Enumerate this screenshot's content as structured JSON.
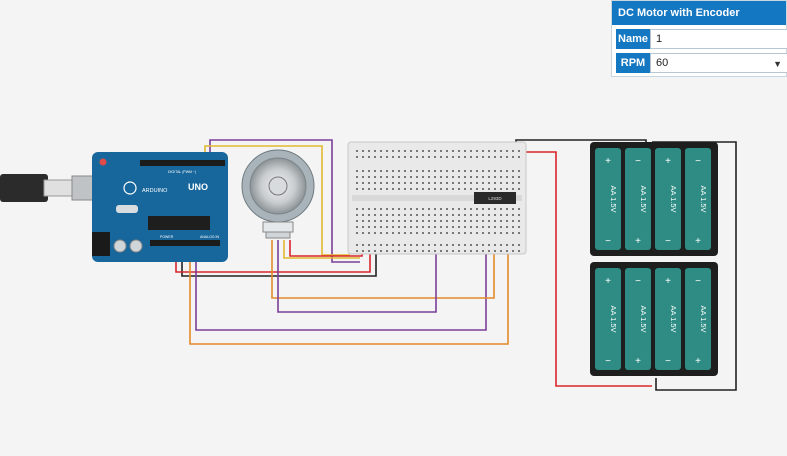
{
  "inspector": {
    "title": "DC Motor with Encoder",
    "fields": [
      {
        "label": "Name",
        "value": "1"
      },
      {
        "label": "RPM",
        "value": "60",
        "options_visible_selected": "60"
      }
    ]
  },
  "components": {
    "arduino": {
      "brand": "ARDUINO",
      "model": "UNO",
      "header_digital": "DIGITAL (PWM ~)",
      "header_power": "POWER",
      "header_analog": "ANALOG IN"
    },
    "ic": {
      "label": "L293D"
    },
    "battery": {
      "cell_label": "AA 1.5V",
      "plus": "+",
      "minus": "−"
    }
  },
  "colors": {
    "accent": "#1477c2",
    "arduino_board": "#17669c",
    "battery_cell": "#2e8c84",
    "wire_red": "#d7262a",
    "wire_black": "#222222",
    "wire_orange": "#e38a2a",
    "wire_purple": "#7a3f98",
    "wire_yellow": "#e2b92f"
  }
}
